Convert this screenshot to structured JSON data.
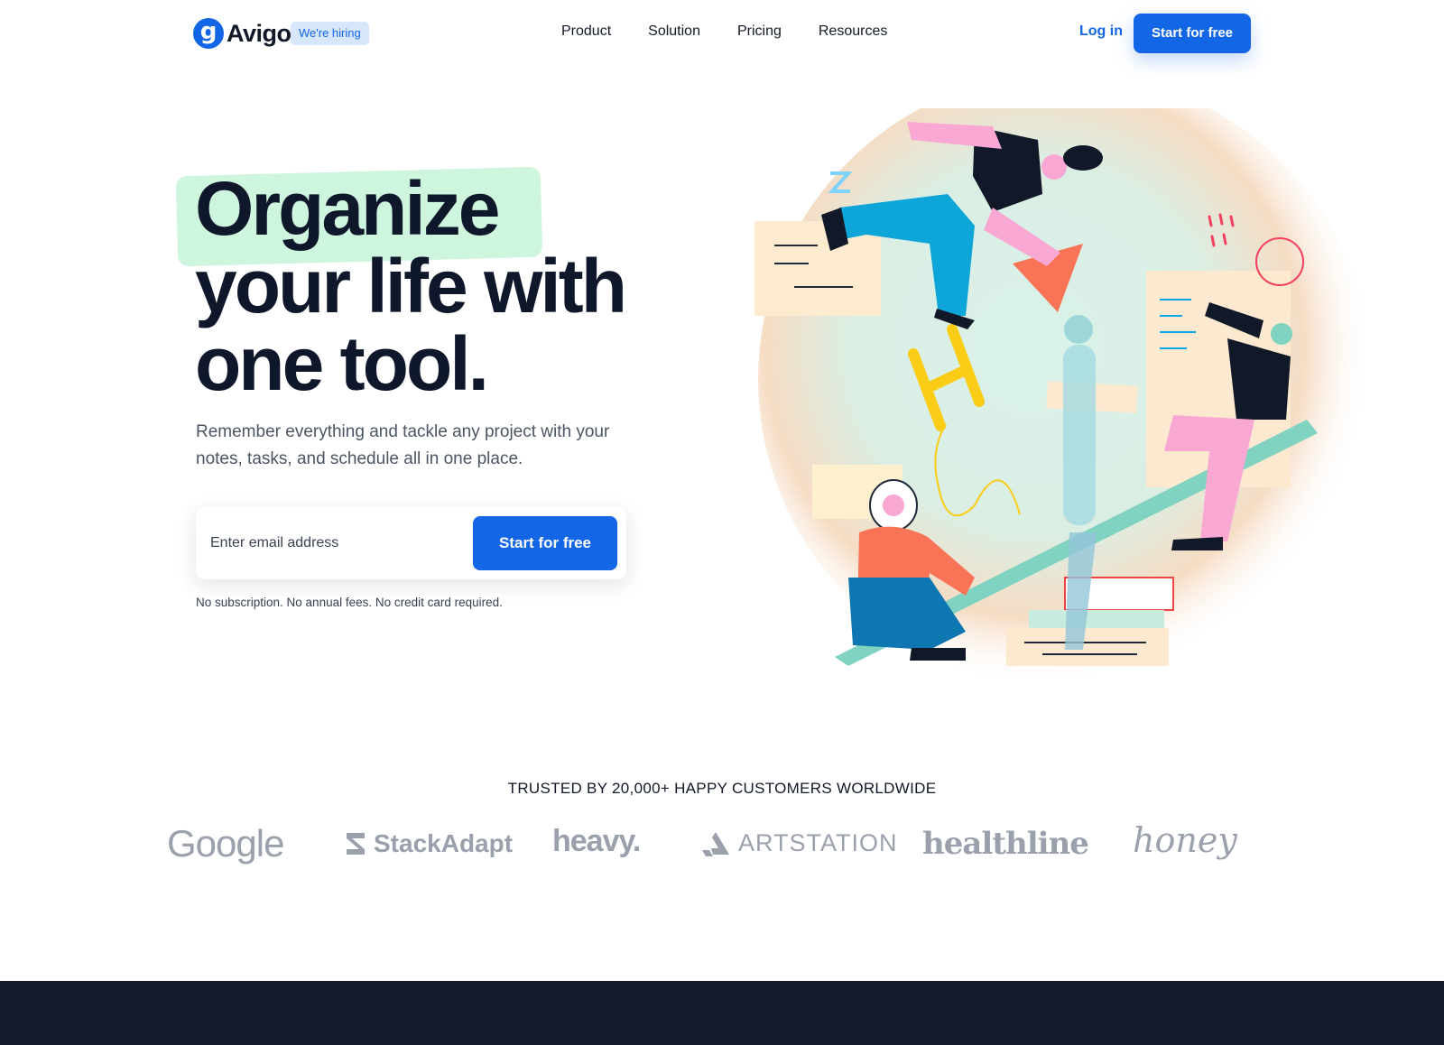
{
  "nav": {
    "logo_mark": "g",
    "logo_text": "Avigo",
    "hiring_badge": "We're hiring",
    "menu": [
      "Product",
      "Solution",
      "Pricing",
      "Resources"
    ],
    "login": "Log in",
    "cta": "Start for free"
  },
  "hero": {
    "headline": [
      "Organize",
      "your life with",
      "one tool."
    ],
    "subtitle": "Remember everything and tackle any project with your notes, tasks, and schedule all in one place.",
    "email_placeholder": "Enter email address",
    "cta": "Start for free",
    "note": "No subscription. No annual fees. No credit card required."
  },
  "trusted": {
    "title": "TRUSTED BY 20,000+ HAPPY CUSTOMERS WORLDWIDE",
    "brands": [
      "Google",
      "StackAdapt",
      "heavy.",
      "ARTSTATION",
      "healthline",
      "honey"
    ]
  },
  "colors": {
    "primary": "#1366e6",
    "highlight": "#c6f3d8",
    "text": "#0f172a",
    "muted": "#4b5563",
    "brand_grey": "#9aa1ad",
    "dark_band": "#131a2c"
  },
  "icons": [
    "avigo-logo-icon",
    "stackadapt-logo-icon",
    "artstation-logo-icon"
  ]
}
